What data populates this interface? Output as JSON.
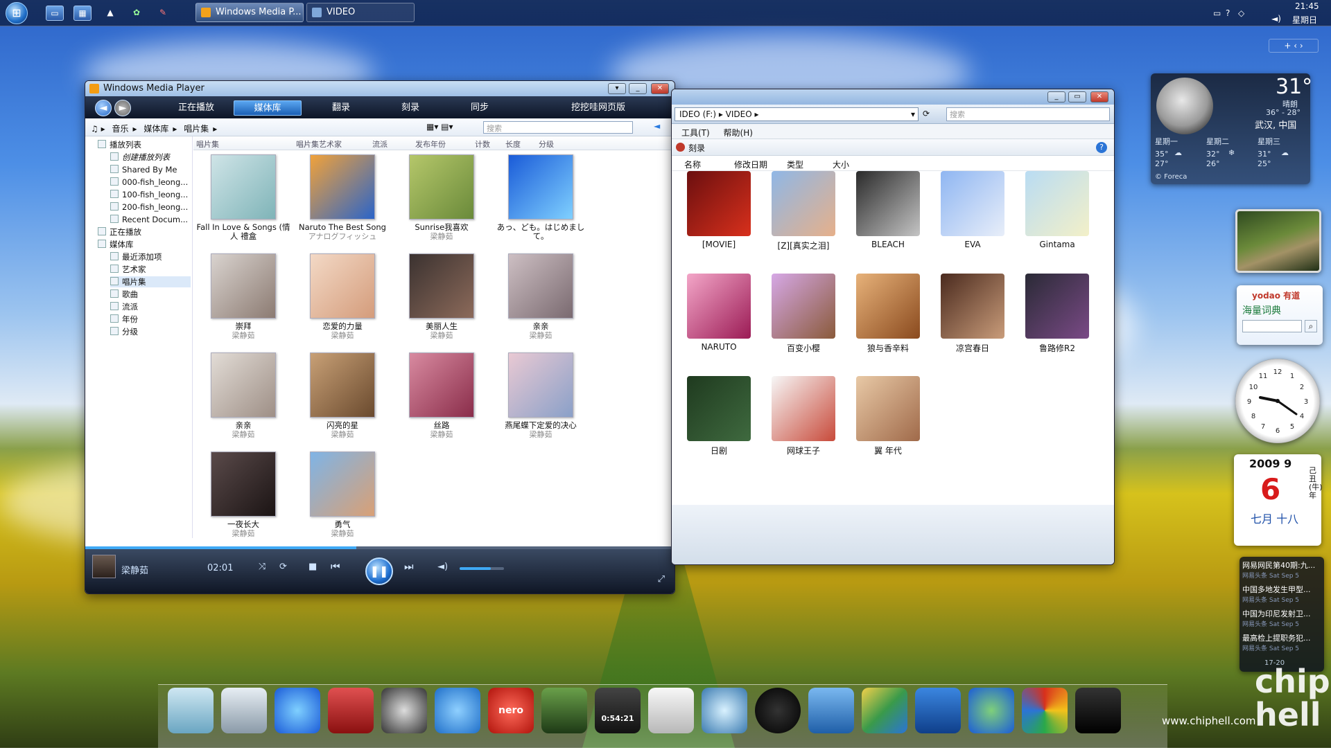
{
  "taskbar": {
    "start_label": "⊞",
    "quicklaunch": [
      {
        "icon": "show-desktop-icon",
        "glyph": "▭"
      },
      {
        "icon": "switch-windows-icon",
        "glyph": "▦"
      },
      {
        "icon": "rocket-icon",
        "glyph": "▲"
      },
      {
        "icon": "flower-icon",
        "glyph": "✿"
      },
      {
        "icon": "tool-icon",
        "glyph": "✎"
      }
    ],
    "tasks": [
      {
        "label": "Windows Media P..."
      },
      {
        "label": "VIDEO"
      }
    ],
    "clock": {
      "time": "21:45",
      "day": "星期日"
    }
  },
  "wmp": {
    "title": "Windows Media Player",
    "tabs": [
      "正在播放",
      "媒体库",
      "翻录",
      "刻录",
      "同步",
      "挖挖哇网页版"
    ],
    "breadcrumb": [
      "音乐",
      "媒体库",
      "唱片集"
    ],
    "search_placeholder": "搜索",
    "tree": [
      "播放列表",
      "创建播放列表",
      "Shared By Me",
      "000-fish_leong...",
      "100-fish_leong...",
      "200-fish_leong...",
      "Recent Docum...",
      "正在播放",
      "媒体库",
      "最近添加项",
      "艺术家",
      "唱片集",
      "歌曲",
      "流派",
      "年份",
      "分级"
    ],
    "columns": [
      "唱片集",
      "唱片集艺术家",
      "流派",
      "发布年份",
      "计数",
      "长度",
      "分级"
    ],
    "albums": [
      {
        "name": "Fall In Love & Songs (情人 禮盒",
        "artist": ""
      },
      {
        "name": "Naruto The Best Song",
        "artist": "アナログフィッシュ"
      },
      {
        "name": "Sunrise我喜欢",
        "artist": "梁静茹"
      },
      {
        "name": "あっ、ども。はじめまして。",
        "artist": ""
      },
      {
        "name": "崇拜",
        "artist": "梁静茹"
      },
      {
        "name": "恋爱的力量",
        "artist": "梁静茹"
      },
      {
        "name": "美丽人生",
        "artist": "梁静茹"
      },
      {
        "name": "亲亲",
        "artist": "梁静茹"
      },
      {
        "name": "亲亲",
        "artist": "梁静茹"
      },
      {
        "name": "闪亮的星",
        "artist": "梁静茹"
      },
      {
        "name": "丝路",
        "artist": "梁静茹"
      },
      {
        "name": "燕尾蝶下定爱的决心",
        "artist": "梁静茹"
      },
      {
        "name": "一夜长大",
        "artist": "梁静茹"
      },
      {
        "name": "勇气",
        "artist": "梁静茹"
      }
    ],
    "player": {
      "artist": "梁静茹",
      "time": "02:01",
      "progress": 0.46,
      "volume": 0.7
    }
  },
  "explorer": {
    "address": [
      "IDEO (F:)",
      "VIDEO"
    ],
    "search_placeholder": "搜索",
    "menu": [
      "工具(T)",
      "帮助(H)"
    ],
    "pane_title": "刻录",
    "columns": [
      "名称",
      "修改日期",
      "类型",
      "大小"
    ],
    "items": [
      "[MOVIE]",
      "[Z][真实之泪]",
      "BLEACH",
      "EVA",
      "Gintama",
      "NARUTO",
      "百变小樱",
      "狼与香辛料",
      "凉宫春日",
      "鲁路修R2",
      "日剧",
      "网球王子",
      "翼 年代"
    ]
  },
  "weather": {
    "temp": "31°",
    "cond": "晴朗",
    "range": "36° - 28°",
    "city": "武汉, 中国",
    "days": [
      {
        "name": "星期一",
        "hi": "35°",
        "lo": "27°"
      },
      {
        "name": "星期二",
        "hi": "32°",
        "lo": "26°"
      },
      {
        "name": "星期三",
        "hi": "31°",
        "lo": "25°"
      }
    ],
    "credit": "© Foreca"
  },
  "dictionary": {
    "brand": "yodao 有道",
    "label": "海量词典"
  },
  "calendar": {
    "ym": "2009 9",
    "day": "6",
    "lunar": "七月 十八",
    "side": "己丑(牛)年"
  },
  "news": [
    {
      "title": "网易网民第40期:九...",
      "sub": "网易头条 Sat Sep 5"
    },
    {
      "title": "中国多地发生甲型...",
      "sub": "网易头条 Sat Sep 5"
    },
    {
      "title": "中国为印尼发射卫...",
      "sub": "网易头条 Sat Sep 5"
    },
    {
      "title": "最高检上提职务犯...",
      "sub": "网易头条 Sat Sep 5"
    }
  ],
  "news_pager": "17-20",
  "dock": [
    "recycle-bin",
    "tasks",
    "internet-explorer",
    "address-book",
    "speedometer",
    "messenger",
    "nero",
    "photo",
    "video-editor",
    "game-controller",
    "globe-media",
    "qq",
    "media-player",
    "office",
    "sync",
    "world",
    "chrome",
    "monitor"
  ],
  "dock_text": {
    "nero": "nero",
    "video": "0:54:21"
  },
  "brand": "www.chiphell.com",
  "logo": "chip hell"
}
